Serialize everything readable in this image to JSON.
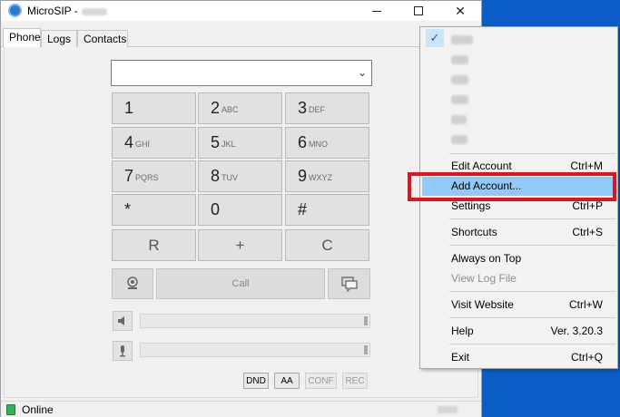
{
  "window": {
    "title": "MicroSIP -",
    "close_glyph": "✕"
  },
  "tabs": [
    {
      "label": "Phone"
    },
    {
      "label": "Logs"
    },
    {
      "label": "Contacts"
    }
  ],
  "dialer": {
    "number_value": "",
    "dropdown_glyph": "⌄",
    "keys": [
      {
        "digit": "1",
        "letters": ""
      },
      {
        "digit": "2",
        "letters": "ABC"
      },
      {
        "digit": "3",
        "letters": "DEF"
      },
      {
        "digit": "4",
        "letters": "GHI"
      },
      {
        "digit": "5",
        "letters": "JKL"
      },
      {
        "digit": "6",
        "letters": "MNO"
      },
      {
        "digit": "7",
        "letters": "PQRS"
      },
      {
        "digit": "8",
        "letters": "TUV"
      },
      {
        "digit": "9",
        "letters": "WXYZ"
      },
      {
        "digit": "*",
        "letters": ""
      },
      {
        "digit": "0",
        "letters": ""
      },
      {
        "digit": "#",
        "letters": ""
      }
    ],
    "redial_label": "R",
    "plus_label": "+",
    "clear_label": "C",
    "call_label": "Call"
  },
  "volume": {
    "speaker_level": 1.0,
    "mic_level": 1.0
  },
  "buttons": {
    "dnd": "DND",
    "aa": "AA",
    "conf": "CONF",
    "rec": "REC"
  },
  "status": {
    "text": "Online",
    "color": "#2fb552"
  },
  "menu": {
    "check_glyph": "✓",
    "items": [
      {
        "label": "Edit Account",
        "shortcut": "Ctrl+M"
      },
      {
        "label": "Add Account...",
        "shortcut": ""
      },
      {
        "label": "Settings",
        "shortcut": "Ctrl+P"
      },
      {
        "label": "Shortcuts",
        "shortcut": "Ctrl+S"
      },
      {
        "label": "Always on Top",
        "shortcut": ""
      },
      {
        "label": "View Log File",
        "shortcut": ""
      },
      {
        "label": "Visit Website",
        "shortcut": "Ctrl+W"
      },
      {
        "label": "Help",
        "shortcut": "Ver. 3.20.3"
      },
      {
        "label": "Exit",
        "shortcut": "Ctrl+Q"
      }
    ],
    "highlight_color": "#91c9f7",
    "annotation_color": "#e0131f"
  }
}
